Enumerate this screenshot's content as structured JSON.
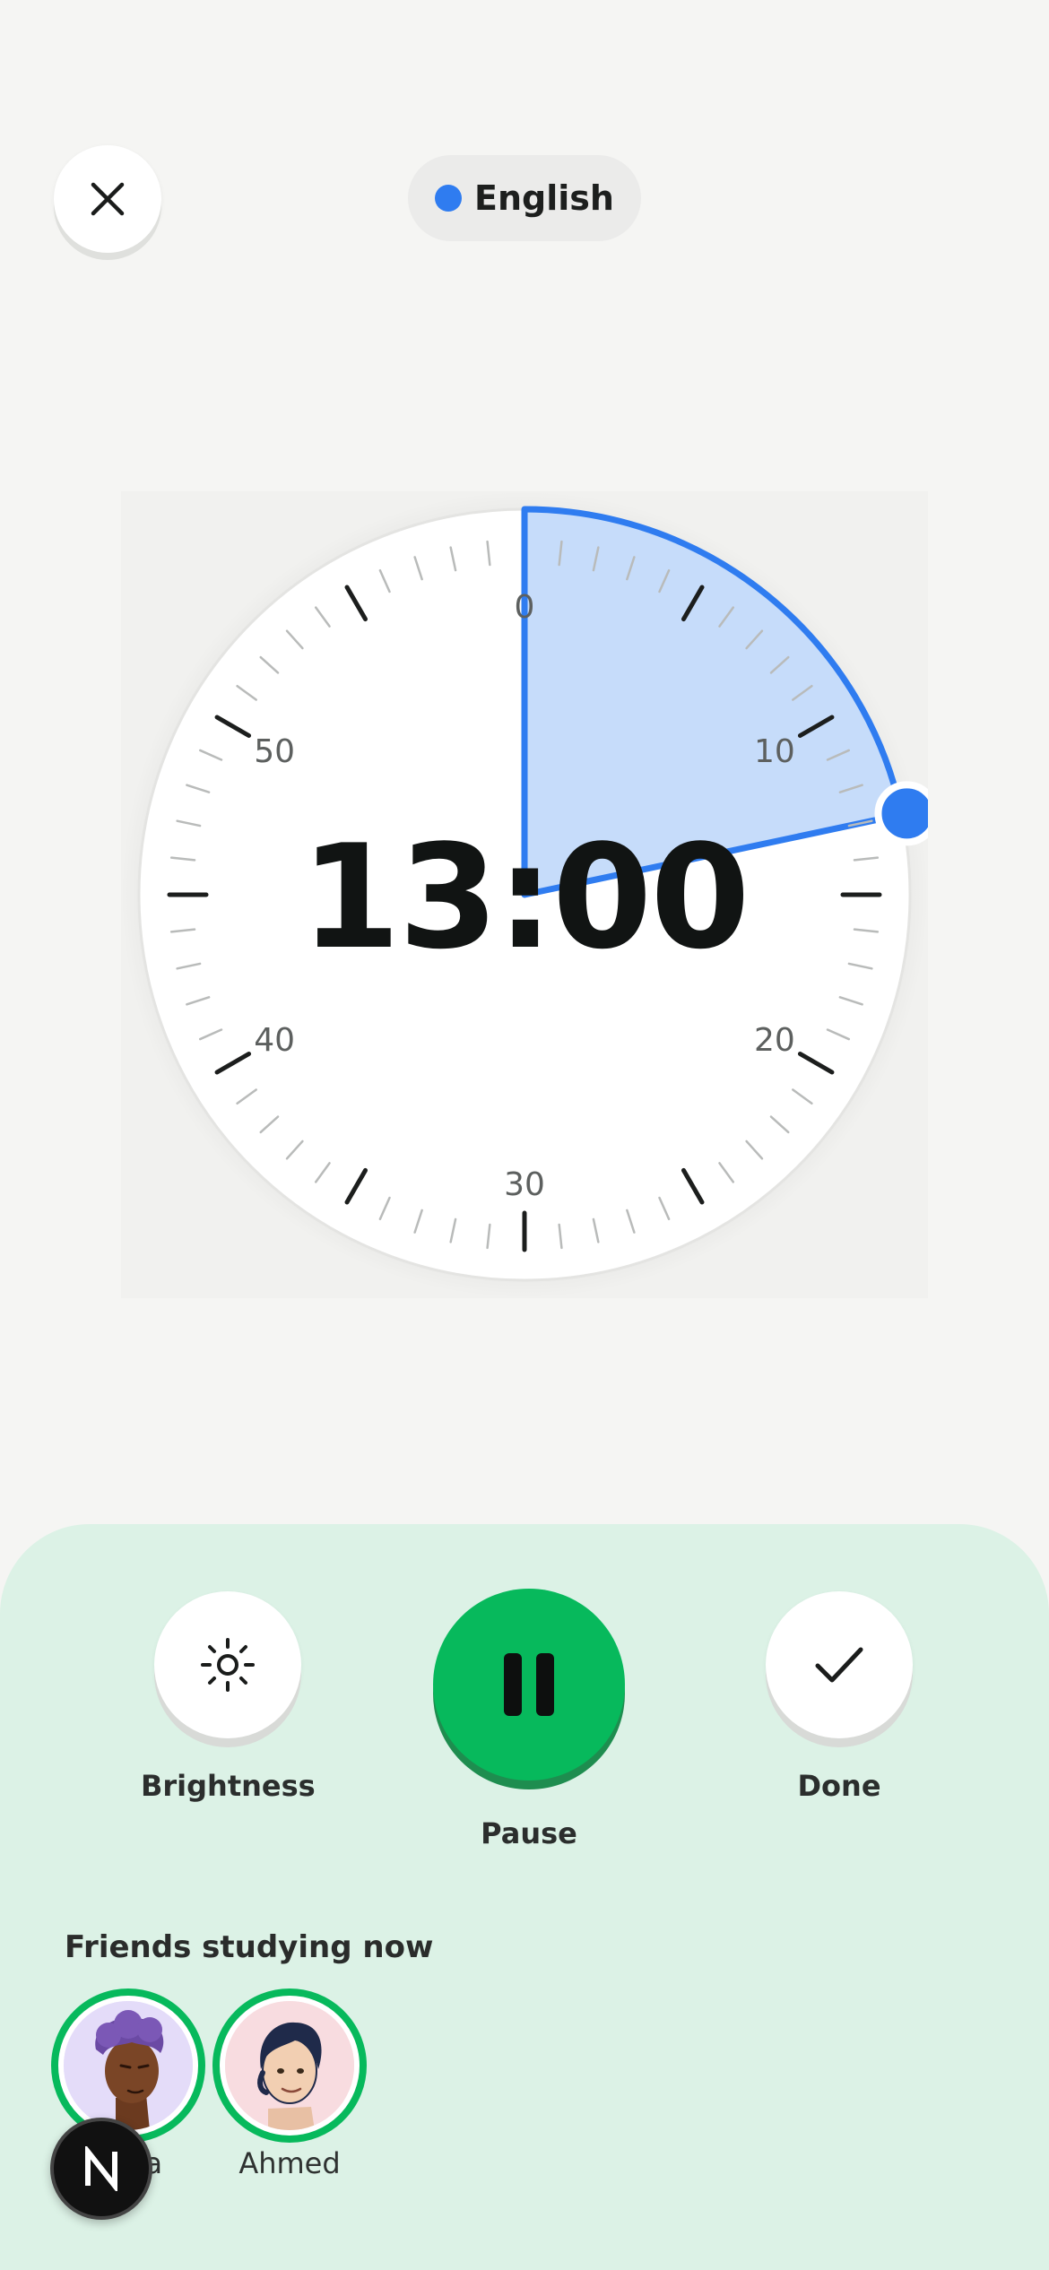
{
  "header": {
    "close_icon": "close-icon",
    "language": {
      "label": "English",
      "dot_color": "#2f7cf0"
    }
  },
  "timer": {
    "display": "13:00",
    "minutes_set": 13,
    "dial_labels": [
      "0",
      "10",
      "20",
      "30",
      "40",
      "50"
    ],
    "accent": "#2f7cf0",
    "fill": "#c6dcfa"
  },
  "controls": {
    "brightness_label": "Brightness",
    "brightness_icon": "sun-icon",
    "pause_label": "Pause",
    "pause_icon": "pause-icon",
    "pause_color": "#07b95c",
    "done_label": "Done",
    "done_icon": "check-icon"
  },
  "friends": {
    "title": "Friends studying now",
    "list": [
      {
        "name": "Nara"
      },
      {
        "name": "Ahmed"
      }
    ]
  },
  "badge": {
    "letter": "N"
  }
}
